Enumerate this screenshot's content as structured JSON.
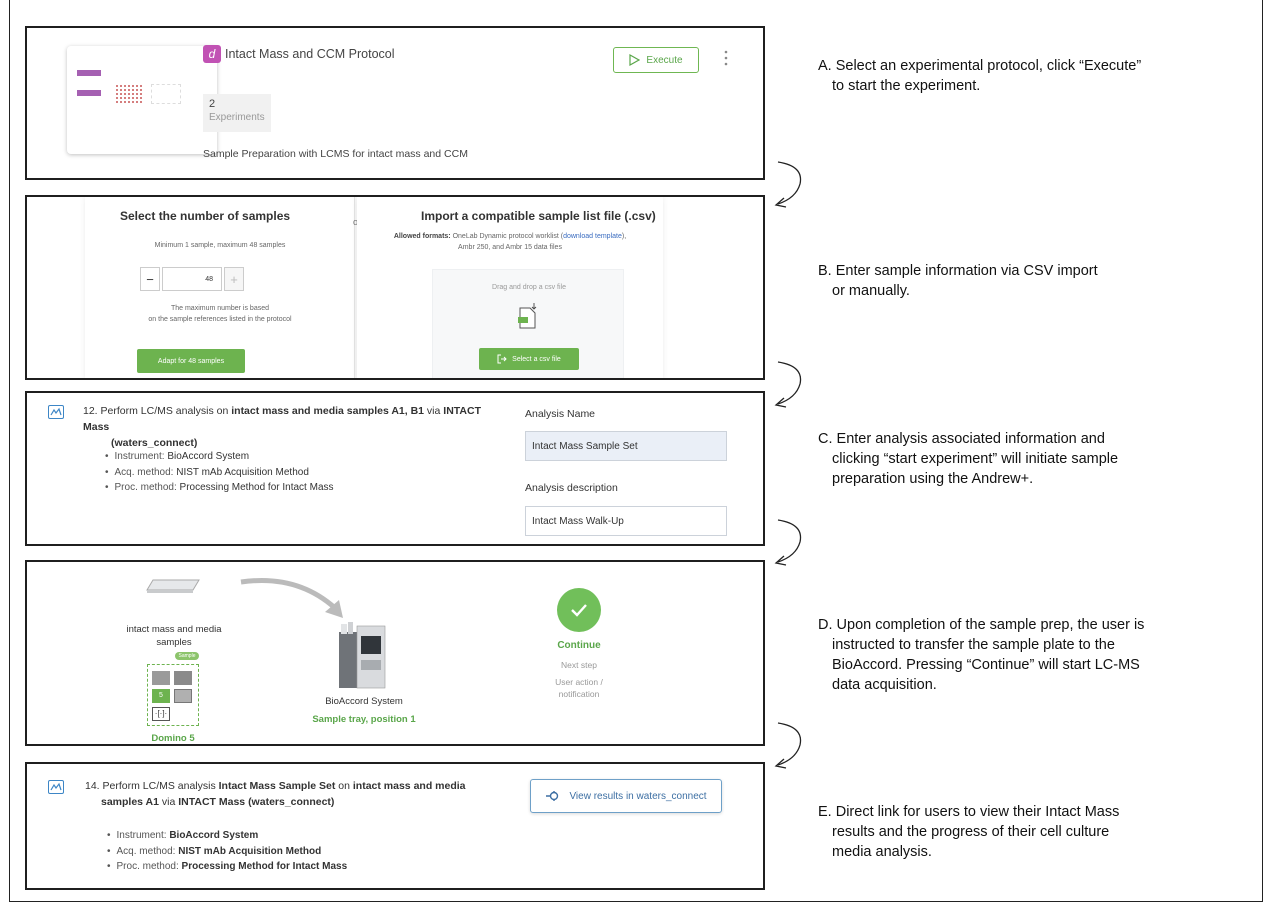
{
  "panel_a": {
    "protocol_icon_letter": "d",
    "protocol_title": "Intact Mass and CCM Protocol",
    "experiments_count": "2",
    "experiments_label": "Experiments",
    "description": "Sample Preparation with LCMS for intact mass and CCM",
    "execute_label": "Execute",
    "more_icon": "⋮"
  },
  "panel_b": {
    "left_title": "Select the number of samples",
    "range_text": "Minimum 1 sample, maximum 48 samples",
    "minus": "−",
    "value": "48",
    "plus": "+",
    "note_line1": "The maximum number is based",
    "note_line2": "on the sample references listed in the protocol",
    "adapt_button": "Adapt for 48 samples",
    "or": "or",
    "right_title": "Import a compatible sample list file (.csv)",
    "allowed_prefix": "Allowed formats:",
    "allowed_text": "OneLab Dynamic protocol worklist (",
    "download_link": "download template",
    "allowed_suffix": "),",
    "allowed_line2": "Ambr 250, and Ambr 15 data files",
    "drop_text": "Drag and drop a csv file",
    "select_button": "Select a csv file"
  },
  "panel_c": {
    "step_prefix": "12. Perform LC/MS analysis on ",
    "step_bold1": "intact mass and media samples A1, B1",
    "step_via": " via ",
    "step_bold2": "INTACT Mass",
    "step_line2": "(waters_connect)",
    "bullets": [
      {
        "k": "Instrument: ",
        "v": "BioAccord System"
      },
      {
        "k": "Acq. method: ",
        "v": "NIST mAb Acquisition Method"
      },
      {
        "k": "Proc. method: ",
        "v": "Processing Method for Intact Mass"
      }
    ],
    "analysis_name_label": "Analysis Name",
    "analysis_name_value": "Intact Mass Sample Set",
    "analysis_desc_label": "Analysis description",
    "analysis_desc_value": "Intact Mass Walk-Up"
  },
  "panel_d": {
    "samples_line1": "intact mass and media",
    "samples_line2": "samples",
    "sample_tag": "Sample",
    "cell_number": "5",
    "domino_label": "Domino 5",
    "instrument_label": "BioAccord System",
    "tray_label": "Sample tray, position 1",
    "continue_label": "Continue",
    "next_step": "Next step",
    "user_action_line1": "User action /",
    "user_action_line2": "notification"
  },
  "panel_e": {
    "step_prefix": "14. Perform LC/MS analysis ",
    "step_bold1": "Intact Mass Sample Set",
    "step_on": " on ",
    "step_bold2": "intact mass and media",
    "step_line2_bold": "samples A1",
    "step_line2_via": " via ",
    "step_line2_bold2": "INTACT Mass (waters_connect)",
    "bullets": [
      {
        "k": "Instrument: ",
        "v": "BioAccord System"
      },
      {
        "k": "Acq. method: ",
        "v": "NIST mAb Acquisition Method"
      },
      {
        "k": "Proc. method: ",
        "v": "Processing Method for Intact Mass"
      }
    ],
    "view_button": "View results in waters_connect"
  },
  "captions": {
    "a": [
      "A. Select an experimental protocol, click “Execute”",
      "to start the experiment."
    ],
    "b": [
      "B. Enter sample information via CSV import",
      "or manually."
    ],
    "c": [
      "C. Enter analysis associated information and",
      "clicking “start experiment” will initiate sample",
      "preparation using the Andrew+."
    ],
    "d": [
      "D. Upon completion of the sample prep, the user is",
      "instructed to transfer the sample plate to the",
      "BioAccord. Pressing “Continue” will start LC-MS",
      "data acquisition."
    ],
    "e": [
      "E. Direct link for users to view their Intact Mass",
      "results and the progress of their cell culture",
      "media analysis."
    ]
  },
  "colors": {
    "accent_green": "#6db34f",
    "protocol_purple": "#c152b4",
    "link_blue": "#3a6cc0"
  }
}
